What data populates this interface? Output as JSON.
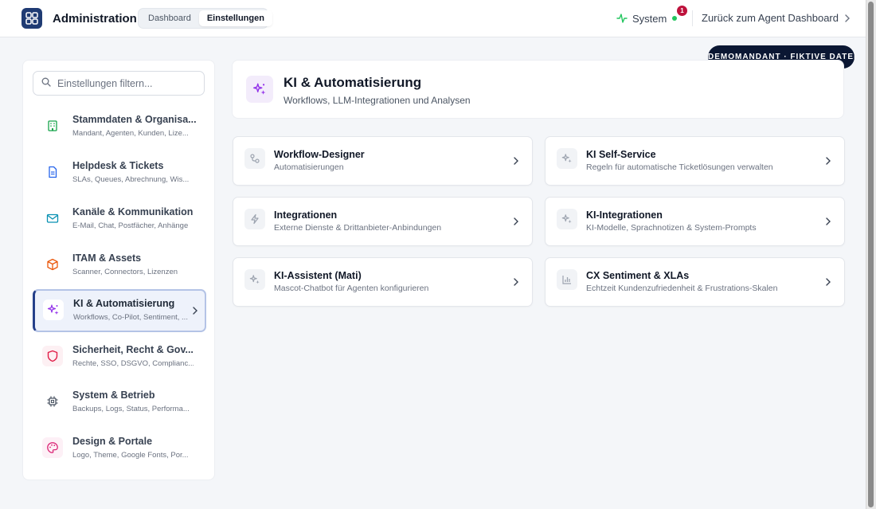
{
  "header": {
    "title": "Administration",
    "tabs": [
      {
        "label": "Dashboard",
        "active": false
      },
      {
        "label": "Einstellungen",
        "active": true
      }
    ],
    "system_label": "System",
    "system_status_color": "#22c55e",
    "notification_count": "1",
    "back_link": "Zurück zum Agent Dashboard"
  },
  "demo_banner": "DEMOMANDANT · FIKTIVE DATEN",
  "sidebar": {
    "filter_placeholder": "Einstellungen filtern...",
    "items": [
      {
        "title": "Stammdaten & Organisa...",
        "subtitle": "Mandant, Agenten, Kunden, Lize...",
        "icon": "building-icon",
        "color": "#16a34a"
      },
      {
        "title": "Helpdesk & Tickets",
        "subtitle": "SLAs, Queues, Abrechnung, Wis...",
        "icon": "document-icon",
        "color": "#2563eb"
      },
      {
        "title": "Kanäle & Kommunikation",
        "subtitle": "E-Mail, Chat, Postfächer, Anhänge",
        "icon": "mail-icon",
        "color": "#0891b2"
      },
      {
        "title": "ITAM & Assets",
        "subtitle": "Scanner, Connectors, Lizenzen",
        "icon": "box-icon",
        "color": "#ea580c"
      },
      {
        "title": "KI & Automatisierung",
        "subtitle": "Workflows, Co-Pilot, Sentiment, ...",
        "icon": "sparkles-icon",
        "color": "#9333ea",
        "active": true
      },
      {
        "title": "Sicherheit, Recht & Gov...",
        "subtitle": "Rechte, SSO, DSGVO, Complianc...",
        "icon": "shield-icon",
        "color": "#e11d48"
      },
      {
        "title": "System & Betrieb",
        "subtitle": "Backups, Logs, Status, Performa...",
        "icon": "chip-icon",
        "color": "#4b5563"
      },
      {
        "title": "Design & Portale",
        "subtitle": "Logo, Theme, Google Fonts, Por...",
        "icon": "palette-icon",
        "color": "#db2777"
      }
    ]
  },
  "page": {
    "title": "KI & Automatisierung",
    "subtitle": "Workflows, LLM-Integrationen und Analysen"
  },
  "cards": [
    {
      "title": "Workflow-Designer",
      "subtitle": "Automatisierungen",
      "icon": "workflow-icon"
    },
    {
      "title": "KI Self-Service",
      "subtitle": "Regeln für automatische Ticketlösungen verwalten",
      "icon": "sparkles-icon"
    },
    {
      "title": "Integrationen",
      "subtitle": "Externe Dienste & Drittanbieter-Anbindungen",
      "icon": "lightning-icon"
    },
    {
      "title": "KI-Integrationen",
      "subtitle": "KI-Modelle, Sprachnotizen & System-Prompts",
      "icon": "sparkles-icon"
    },
    {
      "title": "KI-Assistent (Mati)",
      "subtitle": "Mascot-Chatbot für Agenten konfigurieren",
      "icon": "sparkles-icon"
    },
    {
      "title": "CX Sentiment & XLAs",
      "subtitle": "Echtzeit Kundenzufriedenheit & Frustrations-Skalen",
      "icon": "bar-chart-icon"
    }
  ]
}
